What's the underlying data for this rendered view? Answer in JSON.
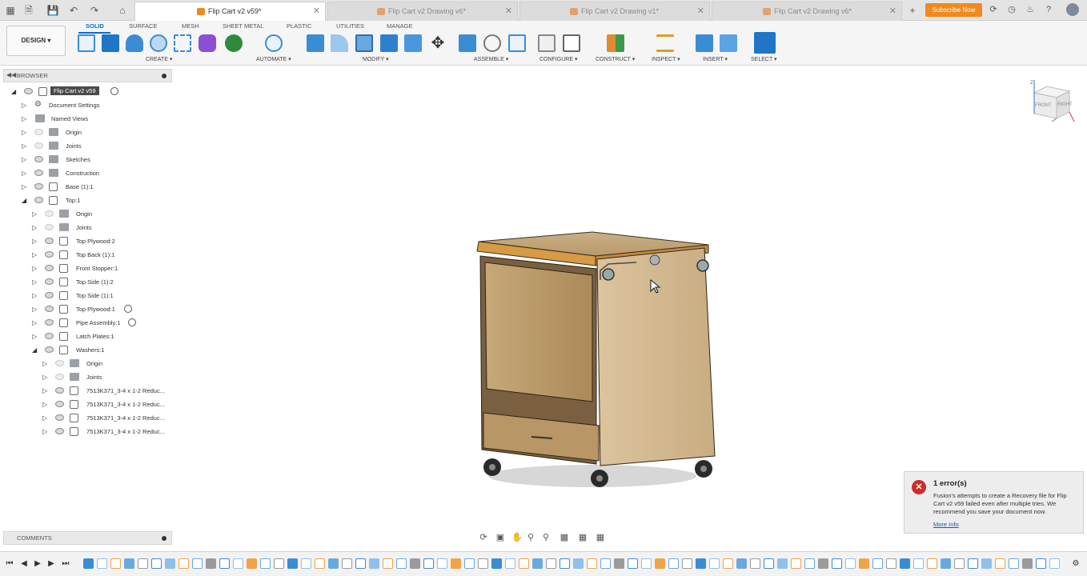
{
  "window": {
    "tabs": [
      {
        "label": "Flip Cart v2 v59*",
        "active": true
      },
      {
        "label": "Flip Cart v2 Drawing v6*",
        "active": false
      },
      {
        "label": "Flip Cart v2 Drawing v1*",
        "active": false
      },
      {
        "label": "Flip Cart v2 Drawing v6*",
        "active": false
      }
    ],
    "subscribe_label": "Subscribe Now"
  },
  "ribbon": {
    "workspace_label": "DESIGN",
    "tabs": [
      "SOLID",
      "SURFACE",
      "MESH",
      "SHEET METAL",
      "PLASTIC",
      "UTILITIES",
      "MANAGE"
    ],
    "groups": [
      "CREATE",
      "AUTOMATE",
      "MODIFY",
      "ASSEMBLE",
      "CONFIGURE",
      "CONSTRUCT",
      "INSPECT",
      "INSERT",
      "SELECT"
    ],
    "accent": "#0a6ec7"
  },
  "browser": {
    "title": "BROWSER",
    "root_label": "Flip Cart v2 v59",
    "items": [
      {
        "label": "Document Settings"
      },
      {
        "label": "Named Views"
      },
      {
        "label": "Origin"
      },
      {
        "label": "Joints"
      },
      {
        "label": "Sketches"
      },
      {
        "label": "Construction"
      },
      {
        "label": "Base (1):1"
      },
      {
        "label": "Top:1"
      },
      {
        "label": "Origin"
      },
      {
        "label": "Joints"
      },
      {
        "label": "Top Plywood:2"
      },
      {
        "label": "Top Back (1):1"
      },
      {
        "label": "Front Stopper:1"
      },
      {
        "label": "Top Side (1):2"
      },
      {
        "label": "Top Side (1):1"
      },
      {
        "label": "Top Plywood:1"
      },
      {
        "label": "Pipe Assembly:1"
      },
      {
        "label": "Latch Plates:1"
      },
      {
        "label": "Washers:1"
      },
      {
        "label": "Origin"
      },
      {
        "label": "Joints"
      },
      {
        "label": "7513K371_3-4 x 1-2 Reduc..."
      },
      {
        "label": "7513K371_3-4 x 1-2 Reduc..."
      },
      {
        "label": "7513K371_3-4 x 1-2 Reduc..."
      },
      {
        "label": "7513K371_3-4 x 1-2 Reduc..."
      }
    ]
  },
  "comments": {
    "title": "COMMENTS"
  },
  "viewcube": {
    "front_label": "FRONT",
    "right_label": "RIGHT",
    "axis_label": "Z"
  },
  "error_toast": {
    "title": "1 error(s)",
    "message": "Fusion's attempts to create a Recovery file for Flip Cart v2 v59 failed even after multiple tries. We recommend you save your document now.",
    "link": "More Info",
    "color": "#d42a2a"
  }
}
